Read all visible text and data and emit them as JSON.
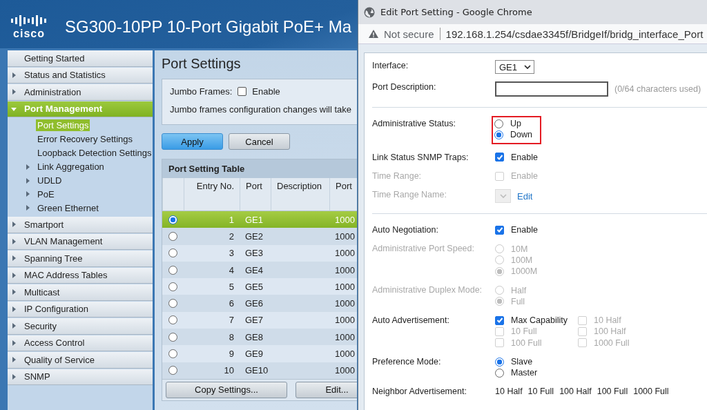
{
  "app": {
    "logo": "cisco",
    "title": "SG300-10PP 10-Port Gigabit PoE+ Ma"
  },
  "sidebar": {
    "items": [
      {
        "label": "Getting Started",
        "kind": "page"
      },
      {
        "label": "Status and Statistics",
        "kind": "folder",
        "expanded": false
      },
      {
        "label": "Administration",
        "kind": "folder",
        "expanded": false
      },
      {
        "label": "Port Management",
        "kind": "folder",
        "expanded": true,
        "children": [
          {
            "label": "Port Settings",
            "kind": "page",
            "selected": true
          },
          {
            "label": "Error Recovery Settings",
            "kind": "page",
            "selected": false
          },
          {
            "label": "Loopback Detection Settings",
            "kind": "page",
            "selected": false
          },
          {
            "label": "Link Aggregation",
            "kind": "folder",
            "selected": false
          },
          {
            "label": "UDLD",
            "kind": "folder",
            "selected": false
          },
          {
            "label": "PoE",
            "kind": "folder",
            "selected": false
          },
          {
            "label": "Green Ethernet",
            "kind": "folder",
            "selected": false
          }
        ]
      },
      {
        "label": "Smartport",
        "kind": "folder",
        "expanded": false
      },
      {
        "label": "VLAN Management",
        "kind": "folder",
        "expanded": false
      },
      {
        "label": "Spanning Tree",
        "kind": "folder",
        "expanded": false
      },
      {
        "label": "MAC Address Tables",
        "kind": "folder",
        "expanded": false
      },
      {
        "label": "Multicast",
        "kind": "folder",
        "expanded": false
      },
      {
        "label": "IP Configuration",
        "kind": "folder",
        "expanded": false
      },
      {
        "label": "Security",
        "kind": "folder",
        "expanded": false
      },
      {
        "label": "Access Control",
        "kind": "folder",
        "expanded": false
      },
      {
        "label": "Quality of Service",
        "kind": "folder",
        "expanded": false
      },
      {
        "label": "SNMP",
        "kind": "folder",
        "expanded": false
      }
    ]
  },
  "page": {
    "title": "Port Settings",
    "jumbo_frames": {
      "label": "Jumbo Frames:",
      "option": "Enable",
      "checked": false
    },
    "note": "Jumbo frames configuration changes will take",
    "buttons": [
      {
        "label": "Apply",
        "kind": "primary"
      },
      {
        "label": "Cancel",
        "kind": "secondary"
      }
    ]
  },
  "table": {
    "title": "Port Setting Table",
    "columns": [
      "Entry No.",
      "Port",
      "Description",
      "Port"
    ],
    "rows": [
      {
        "selected": true,
        "entry": "1",
        "port": "GE1",
        "column_4": "1000"
      },
      {
        "selected": false,
        "entry": "2",
        "port": "GE2",
        "column_4": "1000"
      },
      {
        "selected": false,
        "entry": "3",
        "port": "GE3",
        "column_4": "1000"
      },
      {
        "selected": false,
        "entry": "4",
        "port": "GE4",
        "column_4": "1000"
      },
      {
        "selected": false,
        "entry": "5",
        "port": "GE5",
        "column_4": "1000"
      },
      {
        "selected": false,
        "entry": "6",
        "port": "GE6",
        "column_4": "1000"
      },
      {
        "selected": false,
        "entry": "7",
        "port": "GE7",
        "column_4": "1000"
      },
      {
        "selected": false,
        "entry": "8",
        "port": "GE8",
        "column_4": "1000"
      },
      {
        "selected": false,
        "entry": "9",
        "port": "GE9",
        "column_4": "1000"
      },
      {
        "selected": false,
        "entry": "10",
        "port": "GE10",
        "column_4": "1000"
      }
    ],
    "buttons": [
      "Copy Settings...",
      "Edit..."
    ]
  },
  "popup": {
    "title": "Edit Port Setting - Google Chrome",
    "security": "Not secure",
    "url": "192.168.1.254/csdae3345f/BridgeIf/bridg_interface_Port",
    "fields": [
      {
        "kind": "select",
        "label": "Interface:",
        "value": "GE1",
        "disabled": false
      },
      {
        "kind": "text",
        "label": "Port Description:",
        "note": "(0/64 characters used)"
      },
      {
        "kind": "divider"
      },
      {
        "kind": "radio",
        "label": "Administrative Status:",
        "disabled": false,
        "highlighted": true,
        "options": [
          {
            "label": "Up",
            "selected": false
          },
          {
            "label": "Down",
            "selected": true
          }
        ]
      },
      {
        "kind": "checkbox",
        "label": "Link Status SNMP Traps:",
        "disabled": false,
        "options": [
          {
            "label": "Enable",
            "checked": true,
            "disabled": false
          }
        ]
      },
      {
        "kind": "checkbox",
        "label": "Time Range:",
        "disabled": true,
        "options": [
          {
            "label": "Enable",
            "checked": false,
            "disabled": true
          }
        ]
      },
      {
        "kind": "select",
        "label": "Time Range Name:",
        "disabled": true,
        "link": "Edit"
      },
      {
        "kind": "divider"
      },
      {
        "kind": "checkbox",
        "label": "Auto Negotiation:",
        "disabled": false,
        "options": [
          {
            "label": "Enable",
            "checked": true,
            "disabled": false
          }
        ]
      },
      {
        "kind": "radio",
        "label": "Administrative Port Speed:",
        "disabled": true,
        "highlighted": false,
        "options": [
          {
            "label": "10M",
            "selected": false
          },
          {
            "label": "100M",
            "selected": false
          },
          {
            "label": "1000M",
            "selected": true
          }
        ]
      },
      {
        "kind": "radio",
        "label": "Administrative Duplex Mode:",
        "disabled": true,
        "highlighted": false,
        "options": [
          {
            "label": "Half",
            "selected": false
          },
          {
            "label": "Full",
            "selected": true
          }
        ]
      },
      {
        "kind": "checkgrid",
        "label": "Auto Advertisement:",
        "disabled": false,
        "options": [
          {
            "label": "Max Capability",
            "checked": true,
            "disabled": false
          },
          {
            "label": "10 Half",
            "checked": false,
            "disabled": true
          },
          {
            "label": "10 Full",
            "checked": false,
            "disabled": true
          },
          {
            "label": "100 Half",
            "checked": false,
            "disabled": true
          },
          {
            "label": "100 Full",
            "checked": false,
            "disabled": true
          },
          {
            "label": "1000 Full",
            "checked": false,
            "disabled": true
          }
        ]
      },
      {
        "kind": "radio",
        "label": "Preference Mode:",
        "disabled": false,
        "highlighted": false,
        "options": [
          {
            "label": "Slave",
            "selected": true
          },
          {
            "label": "Master",
            "selected": false
          }
        ]
      },
      {
        "kind": "textlist",
        "label": "Neighbor Advertisement:",
        "items": [
          "10 Half",
          "10 Full",
          "100 Half",
          "100 Full",
          "1000 Full"
        ]
      }
    ]
  }
}
